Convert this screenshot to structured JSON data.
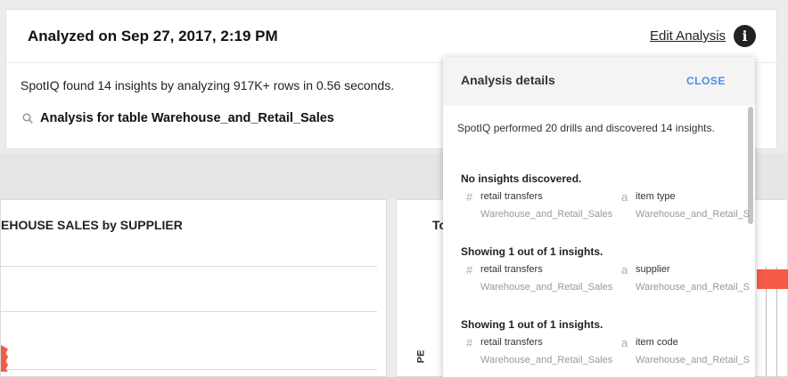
{
  "header": {
    "title": "Analyzed on Sep 27, 2017, 2:19 PM",
    "edit_label": "Edit Analysis",
    "info_icon": "info-icon"
  },
  "summary": {
    "text": "SpotIQ found 14 insights by analyzing 917K+ rows in 0.56 seconds.",
    "table_label": "Analysis for table Warehouse_and_Retail_Sales",
    "search_icon": "search-icon"
  },
  "charts": {
    "left_title": "EHOUSE SALES by SUPPLIER",
    "right_title": "To",
    "right_axis_label": "PE",
    "right_axis_chevron": "›"
  },
  "colors": {
    "accent": "#4a90e2",
    "bar": "#f55b47"
  },
  "panel": {
    "title": "Analysis details",
    "close_label": "CLOSE",
    "summary": "SpotIQ performed 20 drills and discovered 14 insights.",
    "insights": [
      {
        "heading": "No insights discovered.",
        "measure": {
          "symbol": "#",
          "name": "retail transfers",
          "table": "Warehouse_and_Retail_Sales"
        },
        "attribute": {
          "symbol": "a",
          "name": "item type",
          "table": "Warehouse_and_Retail_S"
        }
      },
      {
        "heading": "Showing 1 out of 1 insights.",
        "measure": {
          "symbol": "#",
          "name": "retail transfers",
          "table": "Warehouse_and_Retail_Sales"
        },
        "attribute": {
          "symbol": "a",
          "name": "supplier",
          "table": "Warehouse_and_Retail_S"
        }
      },
      {
        "heading": "Showing 1 out of 1 insights.",
        "measure": {
          "symbol": "#",
          "name": "retail transfers",
          "table": "Warehouse_and_Retail_Sales"
        },
        "attribute": {
          "symbol": "a",
          "name": "item code",
          "table": "Warehouse_and_Retail_S"
        }
      }
    ]
  }
}
